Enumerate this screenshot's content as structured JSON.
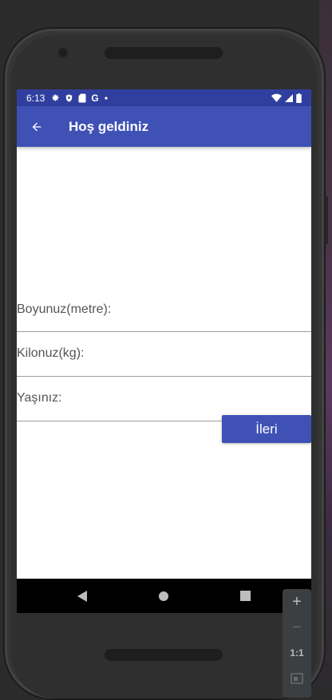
{
  "status_bar": {
    "time": "6:13",
    "icons_left": [
      "gear-icon",
      "shield-icon",
      "sd-card-icon",
      "google-g-icon",
      "dot-icon"
    ],
    "g_text": "G",
    "icons_right": [
      "wifi-icon",
      "signal-icon",
      "battery-icon"
    ]
  },
  "app_bar": {
    "title": "Hoş geldiniz",
    "back_icon": "back-arrow-icon",
    "color": "#3f51b5",
    "status_color": "#303f9f"
  },
  "form": {
    "height_label": "Boyunuz(metre):",
    "height_value": "",
    "weight_label": "Kilonuz(kg):",
    "weight_value": "",
    "age_label": "Yaşınız:",
    "age_value": "",
    "next_button": "İleri"
  },
  "nav_bar": {
    "items": [
      "back-triangle-icon",
      "home-circle-icon",
      "recents-square-icon"
    ]
  },
  "emulator_zoom": {
    "zoom_in": "+",
    "zoom_out": "−",
    "one_to_one": "1:1",
    "fit_icon": "fit-screen-icon"
  }
}
